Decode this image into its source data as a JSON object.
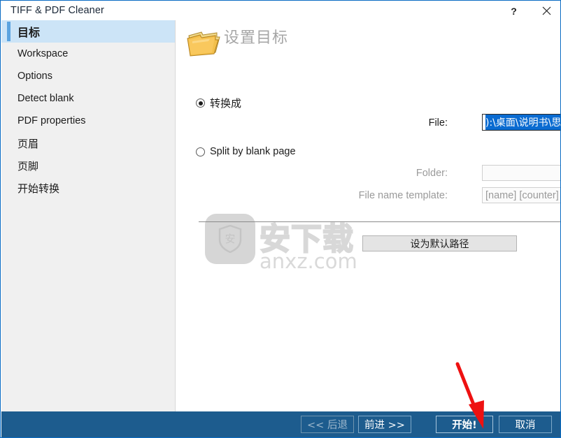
{
  "window": {
    "title": "TIFF & PDF Cleaner",
    "help_label": "?",
    "close_label": "✕"
  },
  "sidebar": {
    "items": [
      {
        "label": "目标",
        "active": true
      },
      {
        "label": "Workspace",
        "active": false
      },
      {
        "label": "Options",
        "active": false
      },
      {
        "label": "Detect blank",
        "active": false
      },
      {
        "label": "PDF properties",
        "active": false
      },
      {
        "label": "页眉",
        "active": false
      },
      {
        "label": "页脚",
        "active": false
      },
      {
        "label": "开始转换",
        "active": false
      }
    ]
  },
  "page": {
    "title": "设置目标",
    "icon": "folder-icon"
  },
  "form": {
    "radio_convert_label": "转换成",
    "radio_split_label": "Split by blank page",
    "file_label": "File:",
    "file_value": "):\\桌面\\说明书\\思迅天店 店铺管理系统.pdf",
    "folder_label": "Folder:",
    "folder_value": "",
    "template_label": "File name template:",
    "template_placeholder": "[name] [counter]",
    "browse_label": "...",
    "default_path_label": "设为默认路径"
  },
  "footer": {
    "back_label": "<< 后退",
    "next_label": "前进 >>",
    "start_label": "开始!",
    "cancel_label": "取消"
  },
  "watermark": {
    "text": "安下载",
    "domain": "anxz.com",
    "logo_char": "安"
  },
  "colors": {
    "window_border": "#0a6cc4",
    "sidebar_bg": "#f0f0f0",
    "sidebar_active_bg": "#cce4f7",
    "sidebar_accent": "#5ba3e0",
    "footer_bg": "#1d5c8e",
    "selection_bg": "#0a6bd1",
    "arrow": "#ee1111"
  }
}
